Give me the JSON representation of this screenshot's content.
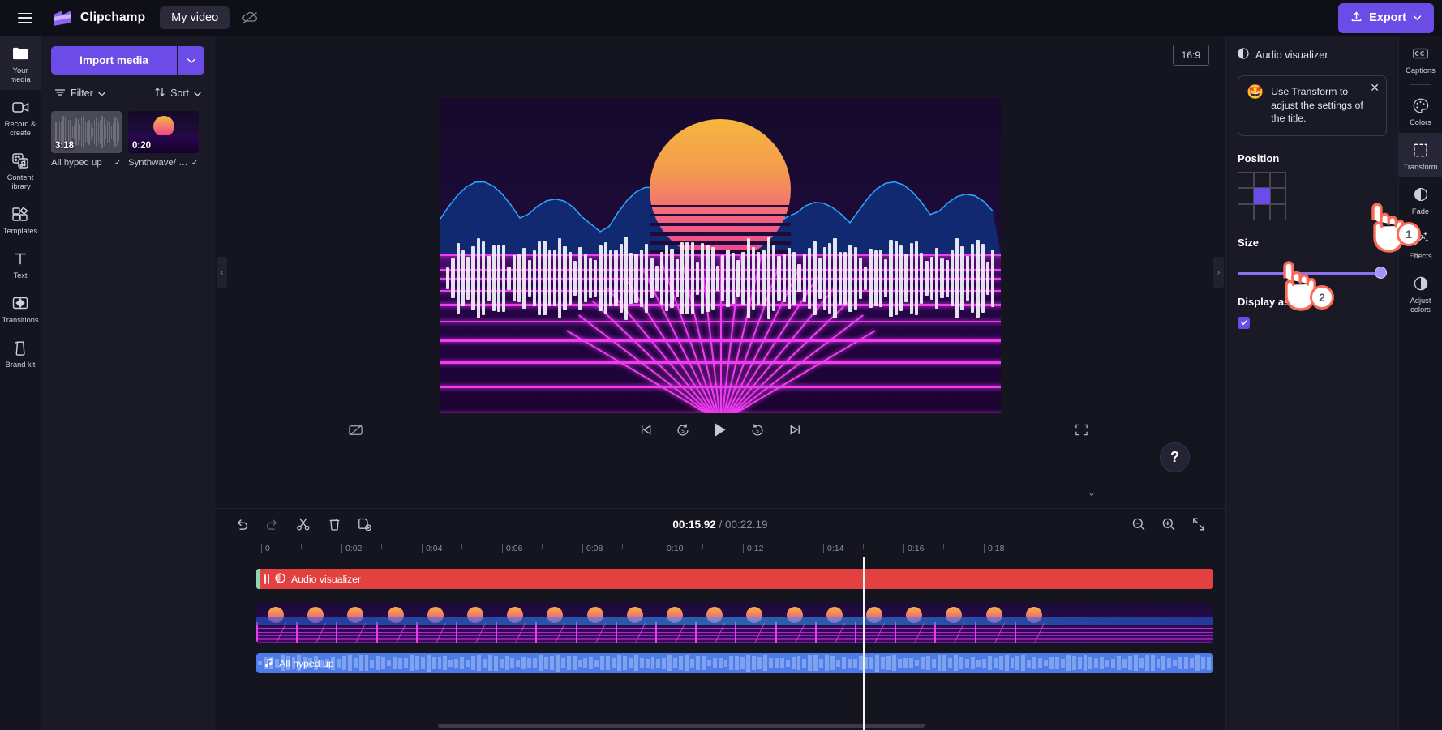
{
  "topbar": {
    "menu_icon": "hamburger-icon",
    "brand": "Clipchamp",
    "project_name": "My video",
    "cloud_icon": "cloud-off-icon",
    "export_label": "Export",
    "export_icon": "upload-icon",
    "accent_color": "#6b4ce6"
  },
  "left_rail": {
    "items": [
      {
        "label": "Your media",
        "icon": "folder-icon",
        "active": true
      },
      {
        "label": "Record & create",
        "icon": "video-camera-icon",
        "active": false
      },
      {
        "label": "Content library",
        "icon": "library-icon",
        "active": false
      },
      {
        "label": "Templates",
        "icon": "templates-icon",
        "active": false
      },
      {
        "label": "Text",
        "icon": "text-icon",
        "active": false
      },
      {
        "label": "Transitions",
        "icon": "transitions-icon",
        "active": false
      },
      {
        "label": "Brand kit",
        "icon": "brand-kit-icon",
        "active": false
      }
    ]
  },
  "media_panel": {
    "import_label": "Import media",
    "import_caret_icon": "chevron-down-icon",
    "filter_label": "Filter",
    "filter_icon": "filter-icon",
    "sort_label": "Sort",
    "sort_icon": "sort-arrows-icon",
    "items": [
      {
        "name": "All hyped up",
        "duration": "3:18",
        "kind": "audio",
        "check_icon": "check-icon"
      },
      {
        "name": "Synthwave/ v...",
        "duration": "0:20",
        "kind": "video",
        "check_icon": "check-icon"
      }
    ]
  },
  "preview": {
    "ratio_label": "16:9",
    "collapse_left_icon": "chevron-left-icon",
    "collapse_right_icon": "chevron-right-icon",
    "help_label": "?",
    "chevron_down_icon": "chevron-down-icon",
    "controls": {
      "captions_off_icon": "captions-off-icon",
      "skip_start_icon": "skip-to-start-icon",
      "rewind_label": "5",
      "rewind_icon": "rewind-5-icon",
      "play_icon": "play-icon",
      "forward_label": "5",
      "forward_icon": "forward-5-icon",
      "skip_end_icon": "skip-to-end-icon",
      "fullscreen_icon": "fullscreen-icon"
    }
  },
  "timeline": {
    "tools": [
      {
        "name": "undo",
        "icon": "undo-icon",
        "dim": false
      },
      {
        "name": "redo",
        "icon": "redo-icon",
        "dim": true
      },
      {
        "name": "split",
        "icon": "scissors-icon",
        "dim": false
      },
      {
        "name": "delete",
        "icon": "trash-icon",
        "dim": false
      },
      {
        "name": "duplicate",
        "icon": "duplicate-icon",
        "dim": false
      }
    ],
    "current_time": "00:15.92",
    "separator": "/",
    "total_time": "00:22.19",
    "zoom_out_icon": "zoom-out-icon",
    "zoom_in_icon": "zoom-in-icon",
    "fit_icon": "fit-to-screen-icon",
    "ruler_ticks": [
      "0",
      "0:02",
      "0:04",
      "0:06",
      "0:08",
      "0:10",
      "0:12",
      "0:14",
      "0:16",
      "0:18"
    ],
    "playhead_time": "0:16",
    "clips": [
      {
        "label": "Audio visualizer",
        "icon": "audio-visualizer-icon",
        "kind": "effect",
        "color": "#e2413f",
        "selected": true
      },
      {
        "label": "",
        "icon": "",
        "kind": "video",
        "color": "#2a0b4d",
        "selected": false
      },
      {
        "label": "All hyped up",
        "icon": "music-note-icon",
        "kind": "audio",
        "color": "#4d7ce8",
        "selected": false
      }
    ]
  },
  "properties": {
    "title": "Audio visualizer",
    "title_icon": "contrast-circle-icon",
    "tip": {
      "emoji": "🤩",
      "text": "Use Transform to adjust the settings of the title.",
      "close_icon": "close-icon"
    },
    "position_label": "Position",
    "position_selected_index": 4,
    "size_label": "Size",
    "size_value": 100,
    "display_as_bars_label": "Display as bars?",
    "display_as_bars_checked": true
  },
  "right_rail": {
    "items": [
      {
        "label": "Captions",
        "icon": "closed-captions-icon",
        "active": false
      },
      {
        "label": "Colors",
        "icon": "palette-icon",
        "active": false
      },
      {
        "label": "Transform",
        "icon": "transform-icon",
        "active": true
      },
      {
        "label": "Fade",
        "icon": "fade-icon",
        "active": false
      },
      {
        "label": "Effects",
        "icon": "magic-wand-icon",
        "active": false
      },
      {
        "label": "Adjust colors",
        "icon": "adjust-colors-icon",
        "active": false
      }
    ]
  },
  "annotations": [
    {
      "number": "1",
      "target": "transform-rail-button"
    },
    {
      "number": "2",
      "target": "size-slider"
    }
  ]
}
